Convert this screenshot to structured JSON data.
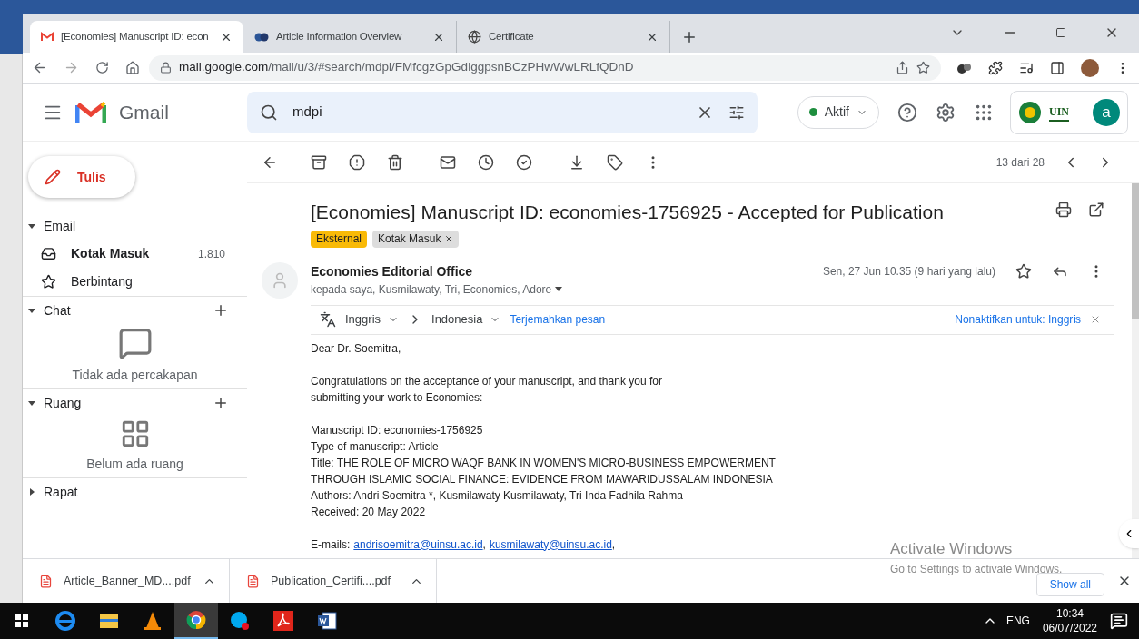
{
  "browser": {
    "tabs": [
      {
        "title": "[Economies] Manuscript ID: econ",
        "selected": true,
        "kind": "gmail"
      },
      {
        "title": "Article Information Overview",
        "selected": false,
        "kind": "mdpi"
      },
      {
        "title": "Certificate",
        "selected": false,
        "kind": "globe"
      }
    ],
    "url_host": "mail.google.com",
    "url_path": "/mail/u/3/#search/mdpi/FMfcgzGpGdlggpsnBCzPHwWwLRLfQDnD"
  },
  "gmail": {
    "product": "Gmail",
    "search_value": "mdpi",
    "status": "Aktif",
    "org_logo": "UIN",
    "avatar": "a",
    "compose": "Tulis",
    "sections": [
      {
        "title": "Email",
        "kind": "folders",
        "expanded": true,
        "items": [
          {
            "label": "Kotak Masuk",
            "count": "1.810",
            "bold": true,
            "kind": "inbox"
          },
          {
            "label": "Berbintang",
            "bold": false,
            "kind": "star"
          }
        ]
      },
      {
        "title": "Chat",
        "kind": "chat",
        "expanded": true,
        "add": true,
        "empty_text": "Tidak ada percakapan"
      },
      {
        "title": "Ruang",
        "kind": "rooms",
        "expanded": true,
        "add": true,
        "empty_text": "Belum ada ruang"
      },
      {
        "title": "Rapat",
        "expanded": false
      }
    ],
    "pager": "13 dari 28",
    "subject": "[Economies] Manuscript ID: economies-1756925 - Accepted for Publication",
    "labels": [
      {
        "text": "Eksternal",
        "removable": false,
        "color": "#f9ba07"
      },
      {
        "text": "Kotak Masuk",
        "removable": true,
        "color": "#dddddd"
      }
    ],
    "sender": "Economies Editorial Office",
    "recipients": "kepada saya, Kusmilawaty, Tri, Economies, Adore",
    "date": "Sen, 27 Jun 10.35 (9 hari yang lalu)",
    "translate": {
      "from": "Inggris",
      "to": "Indonesia",
      "action": "Terjemahkan pesan",
      "disable": "Nonaktifkan untuk: Inggris"
    },
    "body": [
      [
        "Dear Dr. Soemitra,"
      ],
      [
        "Congratulations on the acceptance of your manuscript, and thank you for",
        "submitting your work to Economies:"
      ],
      [
        "Manuscript ID: economies-1756925",
        "Type of manuscript: Article",
        "Title: THE ROLE OF MICRO WAQF BANK IN WOMEN'S MICRO-BUSINESS EMPOWERMENT",
        "THROUGH ISLAMIC SOCIAL FINANCE: EVIDENCE FROM MAWARIDUSSALAM INDONESIA",
        "Authors: Andri Soemitra *, Kusmilawaty Kusmilawaty, Tri Inda Fadhila Rahma",
        "Received: 20 May 2022"
      ]
    ],
    "emails_label": "E-mails:",
    "emails": [
      "andrisoemitra@uinsu.ac.id",
      "kusmilawaty@uinsu.ac.id"
    ],
    "email_separator": ","
  },
  "downloads": {
    "items": [
      "Article_Banner_MD....pdf",
      "Publication_Certifi....pdf"
    ],
    "show_all": "Show all"
  },
  "activation": {
    "title": "Activate Windows",
    "subtitle": "Go to Settings to activate Windows."
  },
  "taskbar": {
    "apps": [
      {
        "kind": "edge",
        "selected": false
      },
      {
        "kind": "explorer",
        "selected": false
      },
      {
        "kind": "vlc",
        "selected": false
      },
      {
        "kind": "chrome",
        "selected": true
      },
      {
        "kind": "skype",
        "selected": false
      },
      {
        "kind": "acrobat",
        "selected": false
      },
      {
        "kind": "word",
        "selected": false
      }
    ],
    "language": "ENG",
    "time": "10:34",
    "date": "06/07/2022"
  }
}
